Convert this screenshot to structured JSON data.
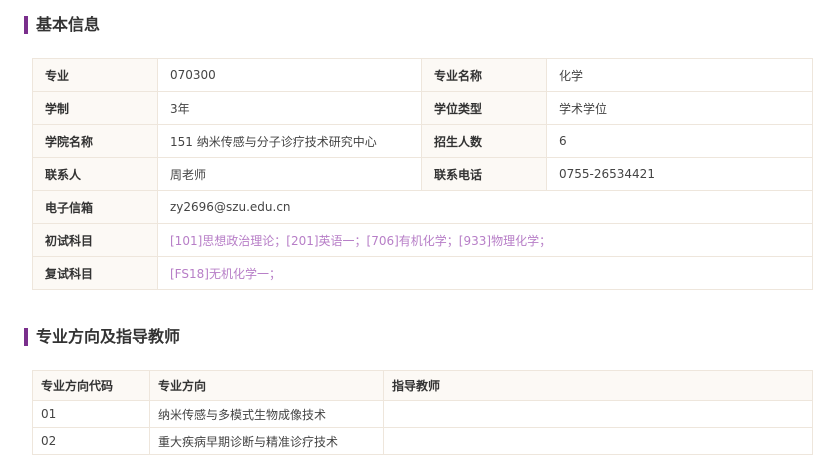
{
  "basic": {
    "title": "基本信息",
    "labels": {
      "major": "专业",
      "major_name": "专业名称",
      "duration": "学制",
      "degree_type": "学位类型",
      "college": "学院名称",
      "enroll": "招生人数",
      "contact": "联系人",
      "phone": "联系电话",
      "email": "电子信箱",
      "first_exam": "初试科目",
      "retest": "复试科目"
    },
    "values": {
      "major": "070300",
      "major_name": "化学",
      "duration": "3年",
      "degree_type": "学术学位",
      "college": "151 纳米传感与分子诊疗技术研究中心",
      "enroll": "6",
      "contact": "周老师",
      "phone": "0755-26534421",
      "email": "zy2696@szu.edu.cn",
      "first_exam": "[101]思想政治理论；[201]英语一；[706]有机化学；[933]物理化学；",
      "retest": "[FS18]无机化学一；"
    }
  },
  "directions": {
    "title": "专业方向及指导教师",
    "headers": [
      "专业方向代码",
      "专业方向",
      "指导教师"
    ],
    "rows": [
      {
        "code": "01",
        "name": "纳米传感与多模式生物成像技术",
        "advisor": ""
      },
      {
        "code": "02",
        "name": "重大疾病早期诊断与精准诊疗技术",
        "advisor": ""
      }
    ]
  },
  "colors": {
    "accent": "#7a2f8c",
    "link": "#b77ec7",
    "label_bg": "#fcf9f5",
    "border": "#eee6dc"
  }
}
